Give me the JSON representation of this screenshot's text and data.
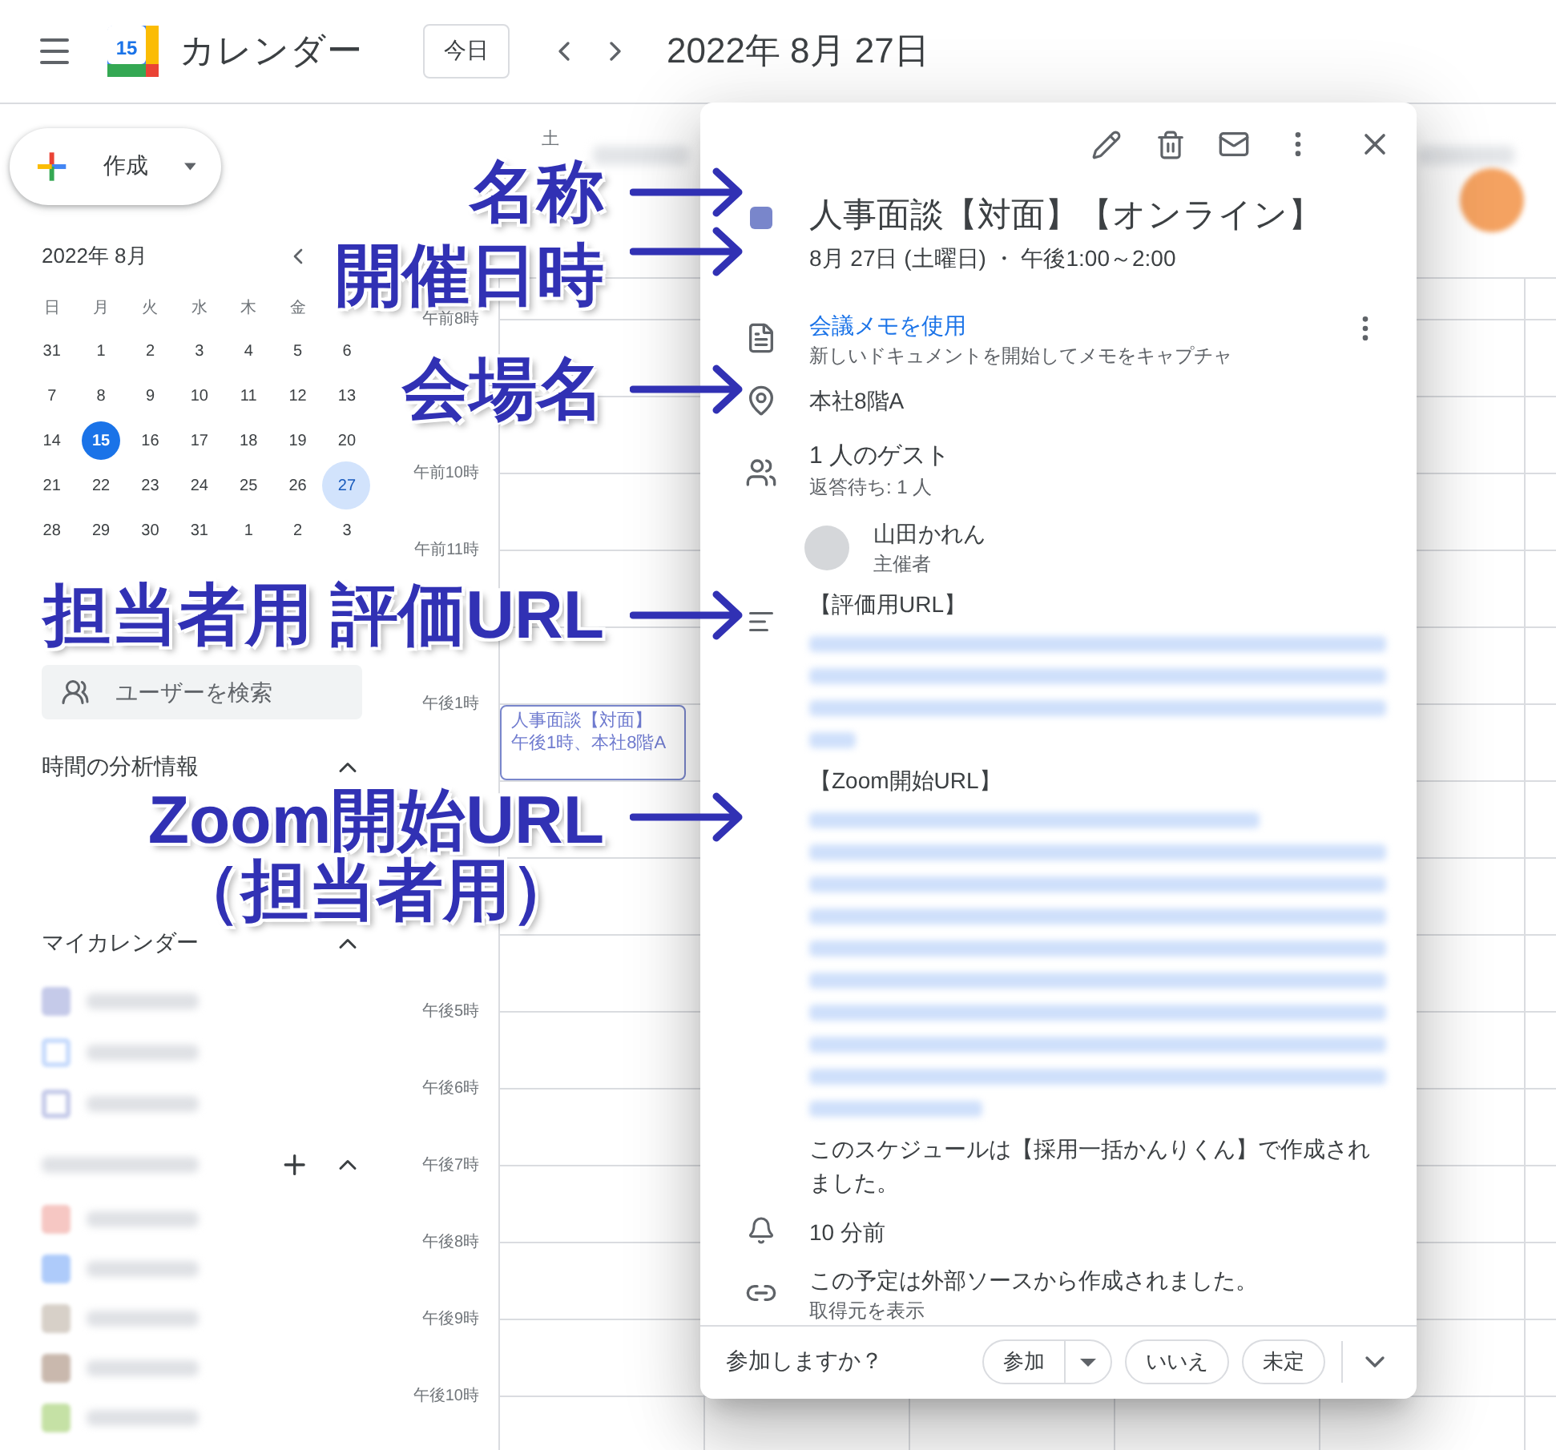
{
  "header": {
    "logo_text": "15",
    "title": "カレンダー",
    "today_button": "今日",
    "date": "2022年 8月 27日"
  },
  "sidebar": {
    "create_button": "作成",
    "mini_calendar": {
      "title": "2022年 8月",
      "weekdays": [
        "日",
        "月",
        "火",
        "水",
        "木",
        "金"
      ],
      "weeks": [
        [
          {
            "day": "31",
            "today": false,
            "selected": false
          },
          {
            "day": "1",
            "today": false,
            "selected": false
          },
          {
            "day": "2",
            "today": false,
            "selected": false
          },
          {
            "day": "3",
            "today": false,
            "selected": false
          },
          {
            "day": "4",
            "today": false,
            "selected": false
          },
          {
            "day": "5",
            "today": false,
            "selected": false
          },
          {
            "day": "6",
            "today": false,
            "selected": false
          }
        ],
        [
          {
            "day": "7",
            "today": false,
            "selected": false
          },
          {
            "day": "8",
            "today": false,
            "selected": false
          },
          {
            "day": "9",
            "today": false,
            "selected": false
          },
          {
            "day": "10",
            "today": false,
            "selected": false
          },
          {
            "day": "11",
            "today": false,
            "selected": false
          },
          {
            "day": "12",
            "today": false,
            "selected": false
          },
          {
            "day": "13",
            "today": false,
            "selected": false
          }
        ],
        [
          {
            "day": "14",
            "today": false,
            "selected": false
          },
          {
            "day": "15",
            "today": true,
            "selected": false
          },
          {
            "day": "16",
            "today": false,
            "selected": false
          },
          {
            "day": "17",
            "today": false,
            "selected": false
          },
          {
            "day": "18",
            "today": false,
            "selected": false
          },
          {
            "day": "19",
            "today": false,
            "selected": false
          },
          {
            "day": "20",
            "today": false,
            "selected": false
          }
        ],
        [
          {
            "day": "21",
            "today": false,
            "selected": false
          },
          {
            "day": "22",
            "today": false,
            "selected": false
          },
          {
            "day": "23",
            "today": false,
            "selected": false
          },
          {
            "day": "24",
            "today": false,
            "selected": false
          },
          {
            "day": "25",
            "today": false,
            "selected": false
          },
          {
            "day": "26",
            "today": false,
            "selected": false
          },
          {
            "day": "27",
            "today": false,
            "selected": true
          }
        ],
        [
          {
            "day": "28",
            "today": false,
            "selected": false
          },
          {
            "day": "29",
            "today": false,
            "selected": false
          },
          {
            "day": "30",
            "today": false,
            "selected": false
          },
          {
            "day": "31",
            "today": false,
            "selected": false
          },
          {
            "day": "1",
            "today": false,
            "selected": false
          },
          {
            "day": "2",
            "today": false,
            "selected": false
          },
          {
            "day": "3",
            "today": false,
            "selected": false
          }
        ]
      ]
    },
    "user_search": {
      "placeholder": "ユーザーを検索"
    },
    "insights": {
      "title": "時間の分析情報",
      "expanded": true
    },
    "my_calendars": {
      "title": "マイカレンダー",
      "expanded": true,
      "items": [
        {
          "color": "#c5cae9",
          "checked": true
        },
        {
          "color": "#c6dafc",
          "checked": false
        },
        {
          "color": "#c5cae9",
          "checked": false
        }
      ]
    },
    "other_calendars": {
      "expanded": true,
      "items": [
        {
          "color": "#f6c7c3",
          "checked": true
        },
        {
          "color": "#aecbfa",
          "checked": true
        },
        {
          "color": "#d7d0c8",
          "checked": true
        },
        {
          "color": "#c9b8ad",
          "checked": true
        },
        {
          "color": "#c5e1a5",
          "checked": true
        }
      ]
    }
  },
  "main": {
    "day_header": "土",
    "hours": [
      {
        "kind": "label",
        "label": "午前8時"
      },
      {
        "kind": "covered"
      },
      {
        "kind": "label",
        "label": "午前10時"
      },
      {
        "kind": "label",
        "label": "午前11時"
      },
      {
        "kind": "covered"
      },
      {
        "kind": "label",
        "label": "午後1時"
      },
      {
        "kind": "covered"
      },
      {
        "kind": "covered"
      },
      {
        "kind": "covered"
      },
      {
        "kind": "label",
        "label": "午後5時"
      },
      {
        "kind": "label",
        "label": "午後6時"
      },
      {
        "kind": "label",
        "label": "午後7時"
      },
      {
        "kind": "label",
        "label": "午後8時"
      },
      {
        "kind": "label",
        "label": "午後9時"
      },
      {
        "kind": "label",
        "label": "午後10時"
      }
    ],
    "event": {
      "title": "人事面談【対面】",
      "subtitle": "午後1時、本社8階A"
    }
  },
  "popup": {
    "title": "人事面談【対面】【オンライン】",
    "color": "#7986cb",
    "date_time": "8月 27日 (土曜日) ・ 午後1:00～2:00",
    "notes": {
      "link": "会議メモを使用",
      "description": "新しいドキュメントを開始してメモをキャプチャ"
    },
    "location": "本社8階A",
    "guests": {
      "count": "1 人のゲスト",
      "pending": "返答待ち: 1 人"
    },
    "organizer": {
      "name": "山田かれん",
      "role": "主催者"
    },
    "description": {
      "eval_heading": "【評価用URL】",
      "zoom_heading": "【Zoom開始URL】",
      "footer": "このスケジュールは【採用一括かんりくん】で作成されました。"
    },
    "reminder": "10 分前",
    "source": {
      "text": "この予定は外部ソースから作成されました。",
      "link": "取得元を表示"
    },
    "rsvp": {
      "question": "参加しますか？",
      "options": [
        {
          "label": "参加",
          "kind": "split",
          "selected": false
        },
        {
          "label": "いいえ",
          "kind": "plain",
          "selected": false
        },
        {
          "label": "未定",
          "kind": "plain",
          "selected": false
        }
      ]
    }
  },
  "annotations": [
    {
      "lines": [
        "名称"
      ]
    },
    {
      "lines": [
        "開催日時"
      ]
    },
    {
      "lines": [
        "会場名"
      ]
    },
    {
      "lines": [
        "担当者用 評価URL"
      ]
    },
    {
      "lines": [
        "Zoom開始URL",
        "（担当者用）"
      ]
    }
  ]
}
